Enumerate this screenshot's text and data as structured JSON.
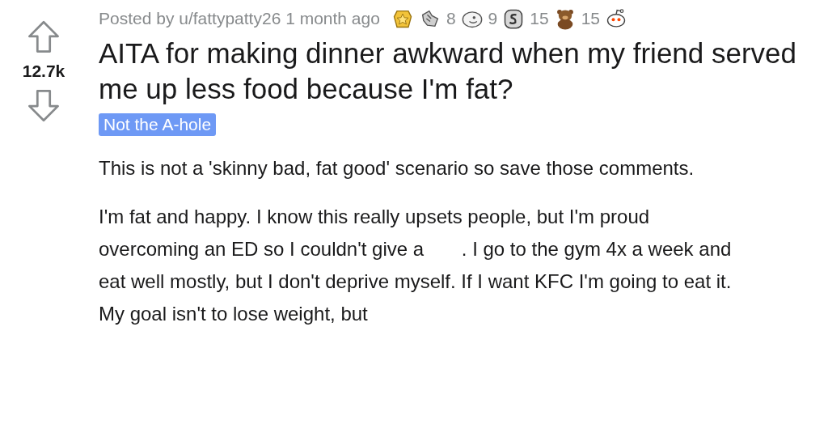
{
  "post": {
    "author_line": "Posted by u/fattypatty26 1 month ago",
    "awards": [
      {
        "kind": "medal"
      },
      {
        "kind": "hands",
        "count": "8"
      },
      {
        "kind": "face",
        "count": "9"
      },
      {
        "kind": "coin",
        "count": "15"
      },
      {
        "kind": "bear",
        "count": "15"
      },
      {
        "kind": "alien"
      }
    ],
    "score": "12.7k",
    "title": "AITA for making dinner awkward when my friend served me up less food because I'm fat?",
    "flair": "Not the A-hole",
    "paragraphs": [
      "This is not a 'skinny bad, fat good' scenario so save those comments.",
      "I'm fat and happy. I know this really upsets people, but I'm proud overcoming an ED so I couldn't give a       . I go to the gym 4x a week and eat well mostly, but I don't deprive myself. If I want KFC I'm going to eat it. My goal isn't to lose weight, but"
    ]
  }
}
